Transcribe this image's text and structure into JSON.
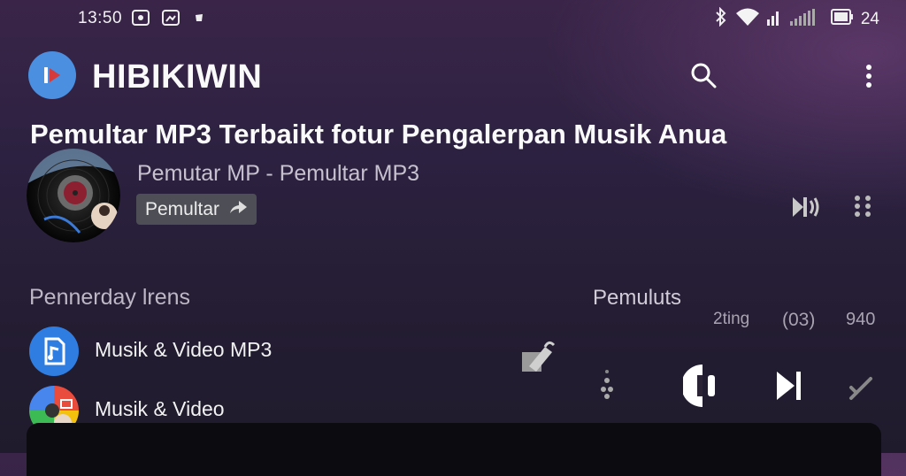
{
  "status_bar": {
    "time": "13:50",
    "battery": "24",
    "icons": [
      "gallery-icon",
      "screenshot-icon",
      "notification-icon",
      "bluetooth-icon",
      "wifi-icon",
      "signal-icon",
      "battery-icon"
    ]
  },
  "app_bar": {
    "title": "HIBIKIWIN",
    "icons": [
      "app-logo-icon",
      "search-icon",
      "more-vert-icon"
    ]
  },
  "headline": "Pemultar MP3 Terbaikt fotur Pengalerpan Musik Anua",
  "now_playing": {
    "subtitle": "Pemutar MP - Pemultar MP3",
    "chip_label": "Pemultar",
    "icons": [
      "album-art",
      "share-arrow-icon",
      "volume-icon",
      "drag-handle-icon"
    ]
  },
  "left_section": {
    "heading": "Pennerday lrens",
    "items": [
      {
        "label": "Musik & Video MP3",
        "icon": "music-file-icon"
      },
      {
        "label": "Musik & Video",
        "icon": "music-video-app-icon"
      }
    ]
  },
  "right_section": {
    "heading": "Pemuluts",
    "labels": [
      "2ting",
      "(03)",
      "940"
    ],
    "icons": [
      "edit-icon",
      "menu-dots-icon",
      "play-pause-icon",
      "skip-next-icon",
      "shuffle-icon"
    ]
  },
  "colors": {
    "logo_bg": "#4a8fe0",
    "chip_bg": "#4e4f56",
    "bottom_sheet": "#0c0b10"
  }
}
